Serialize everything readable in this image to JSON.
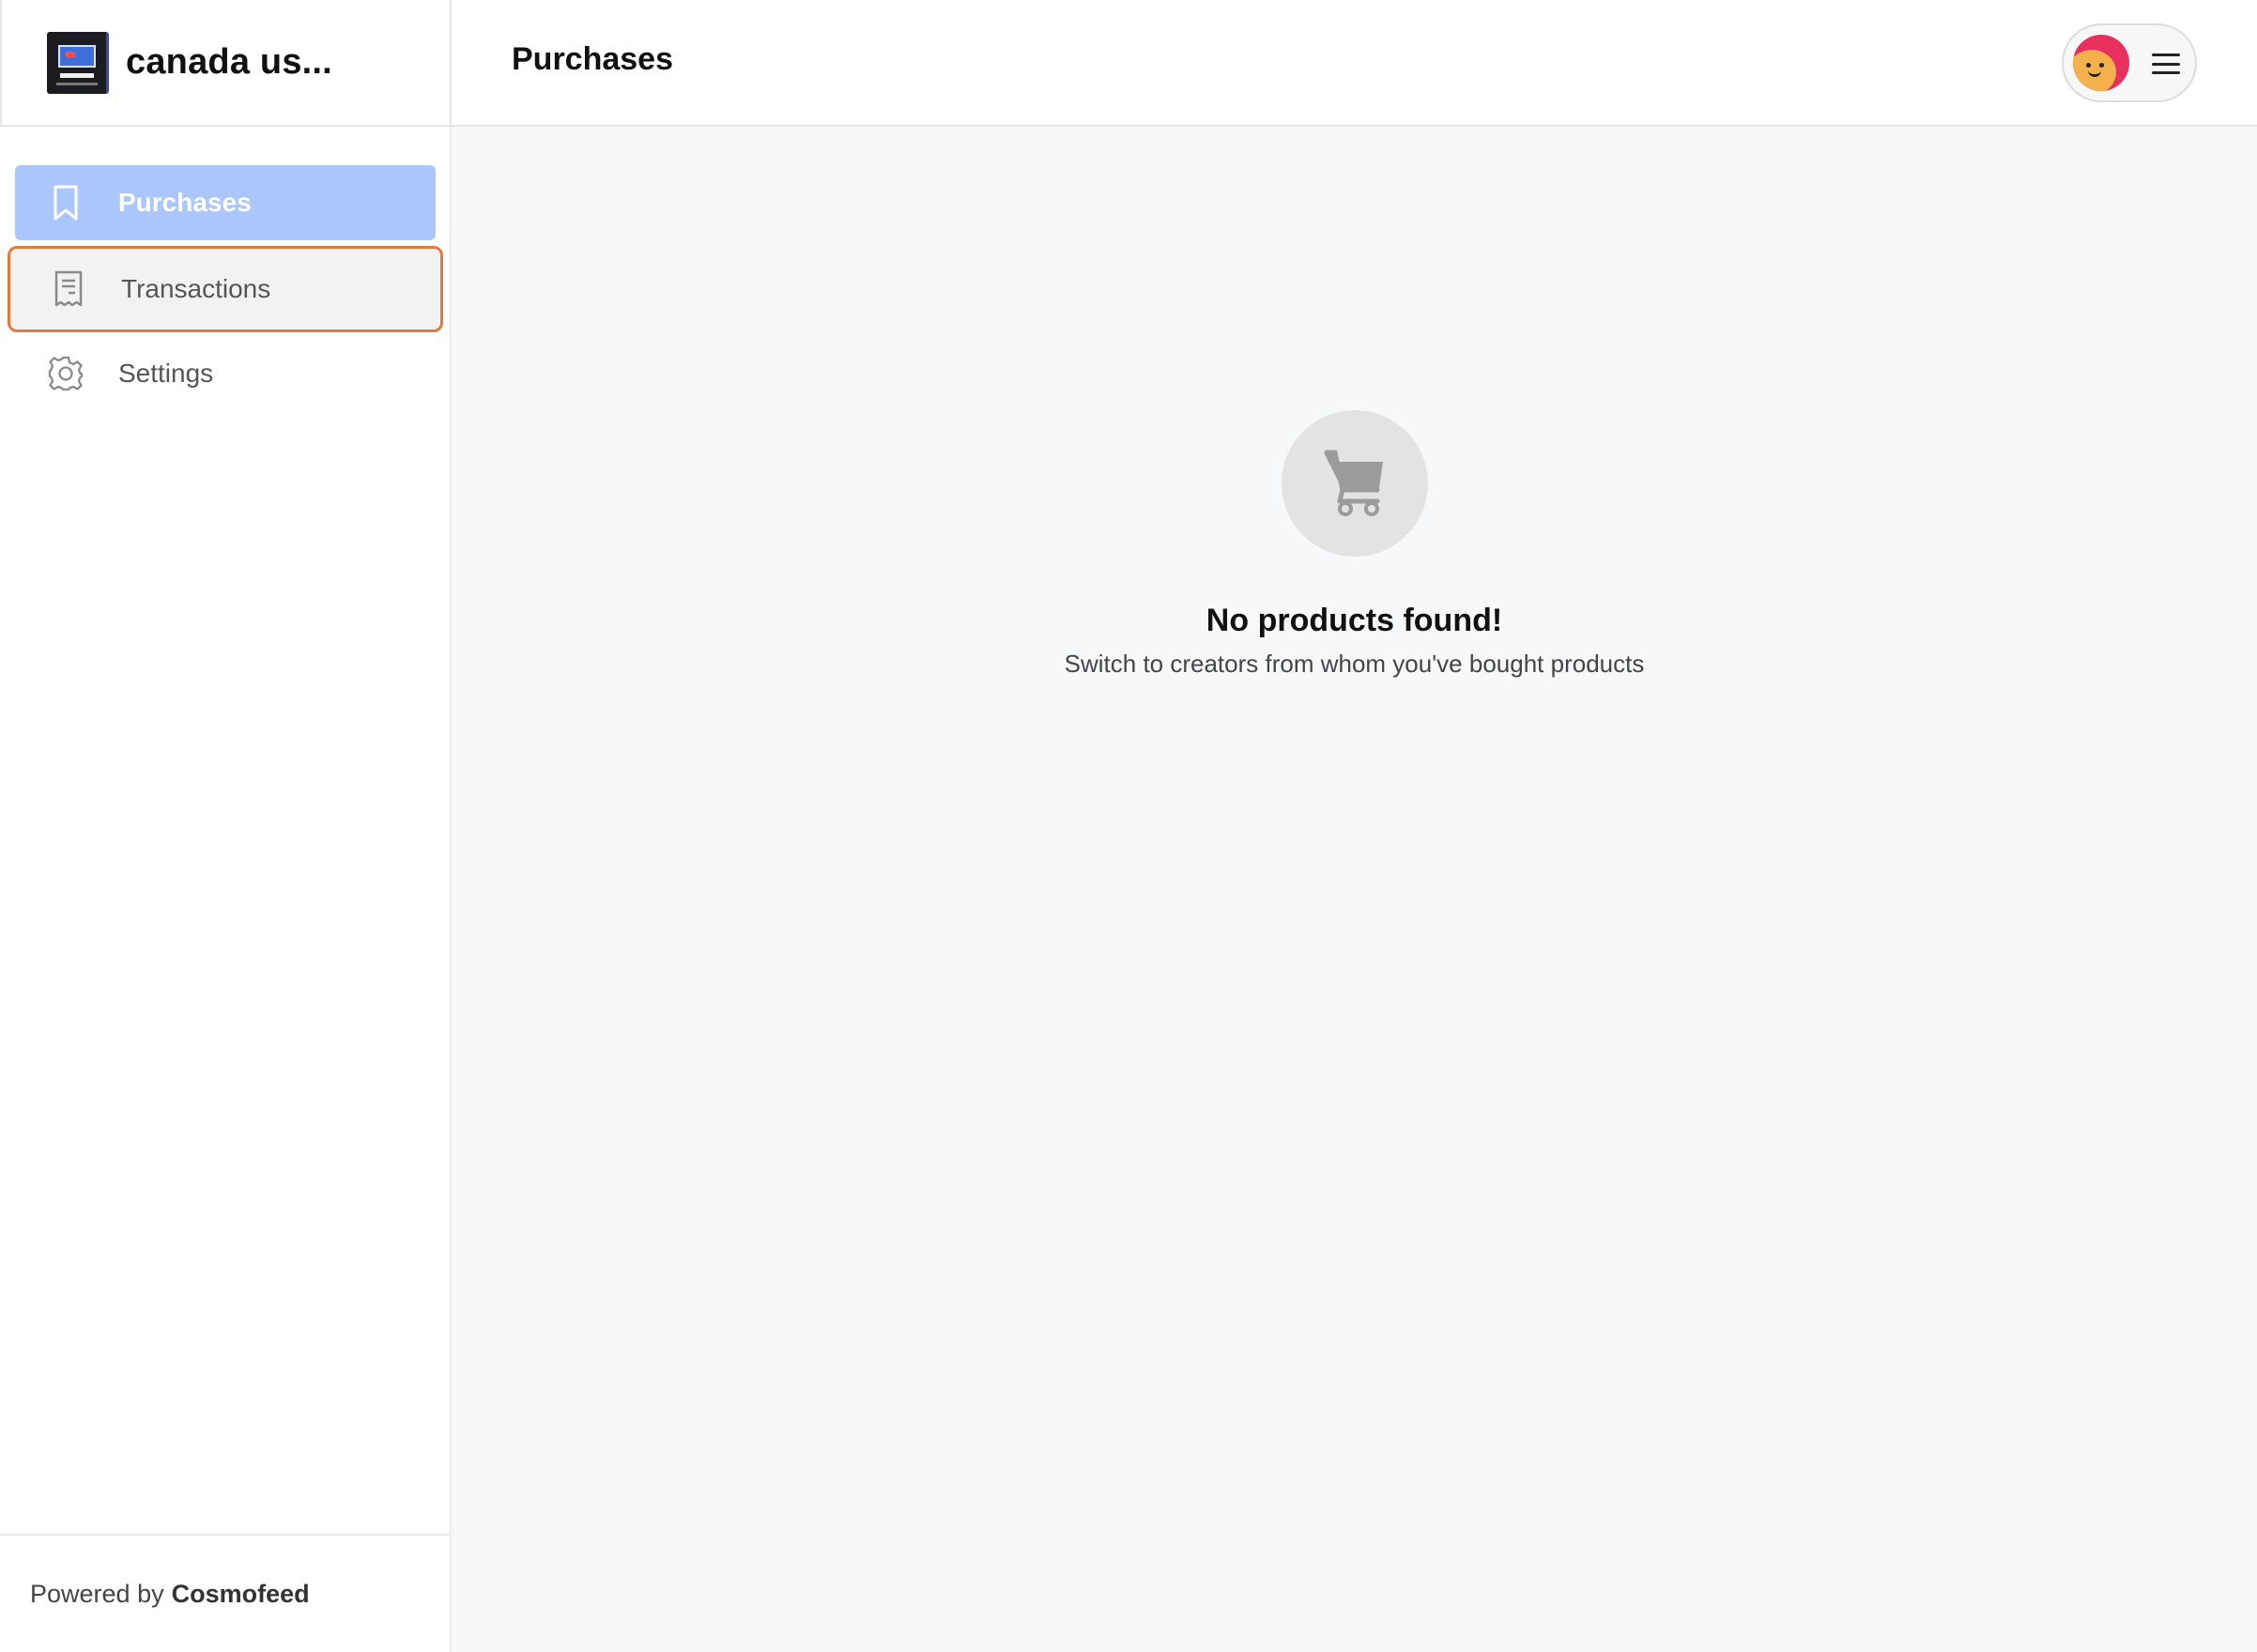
{
  "brand": {
    "name": "canada us..."
  },
  "header": {
    "title": "Purchases"
  },
  "sidebar": {
    "items": [
      {
        "label": "Purchases",
        "icon": "bookmark-icon",
        "active": true
      },
      {
        "label": "Transactions",
        "icon": "receipt-icon",
        "highlighted": true
      },
      {
        "label": "Settings",
        "icon": "gear-icon"
      }
    ],
    "powered_prefix": "Powered by",
    "powered_brand": "Cosmofeed"
  },
  "main": {
    "empty_title": "No products found!",
    "empty_subtitle": "Switch to creators from whom you've bought products",
    "empty_icon": "cart-icon"
  },
  "colors": {
    "active_nav_bg": "#abc6fb",
    "highlight_border": "#e07a3f",
    "main_bg": "#f7f8fa"
  }
}
